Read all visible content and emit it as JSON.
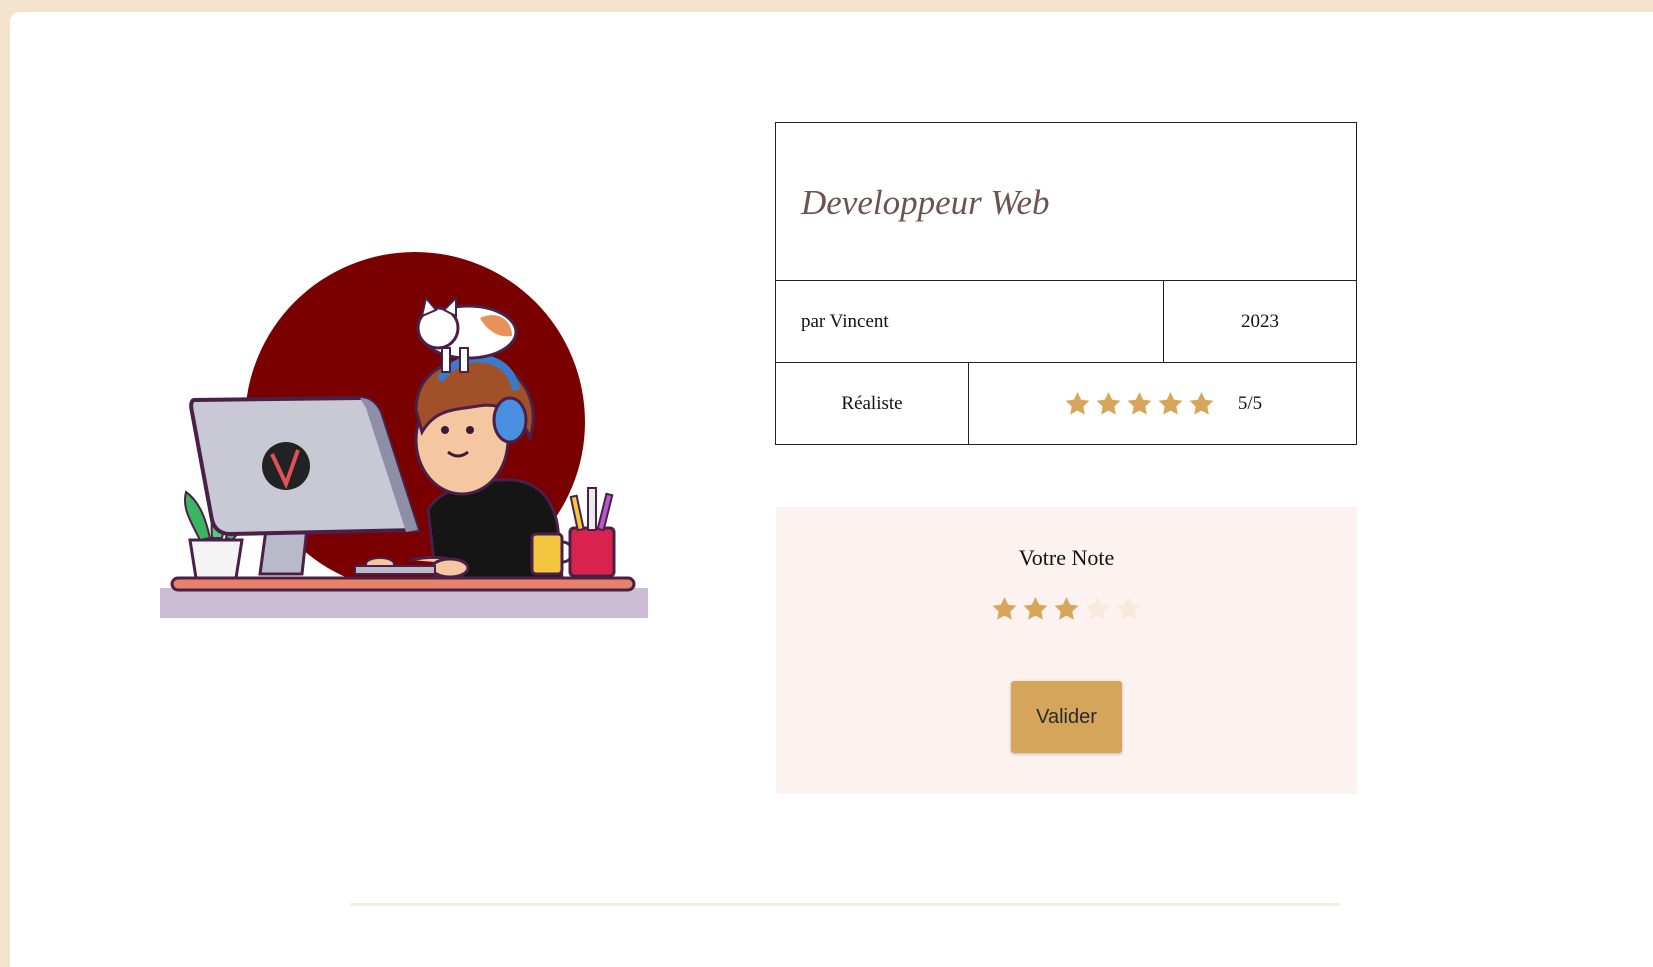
{
  "book": {
    "title": "Developpeur Web",
    "author": "par Vincent",
    "year": "2023",
    "genre": "Réaliste",
    "rating": {
      "value": 5,
      "max": 5,
      "label": "5/5"
    }
  },
  "vote": {
    "title": "Votre Note",
    "selected": 3,
    "max": 5,
    "submit_label": "Valider"
  },
  "colors": {
    "star_filled": "#d8a65b",
    "star_empty": "#f7eadb",
    "button": "#d4a55b",
    "panel": "#fcf2ef",
    "circle": "#7a0000"
  }
}
